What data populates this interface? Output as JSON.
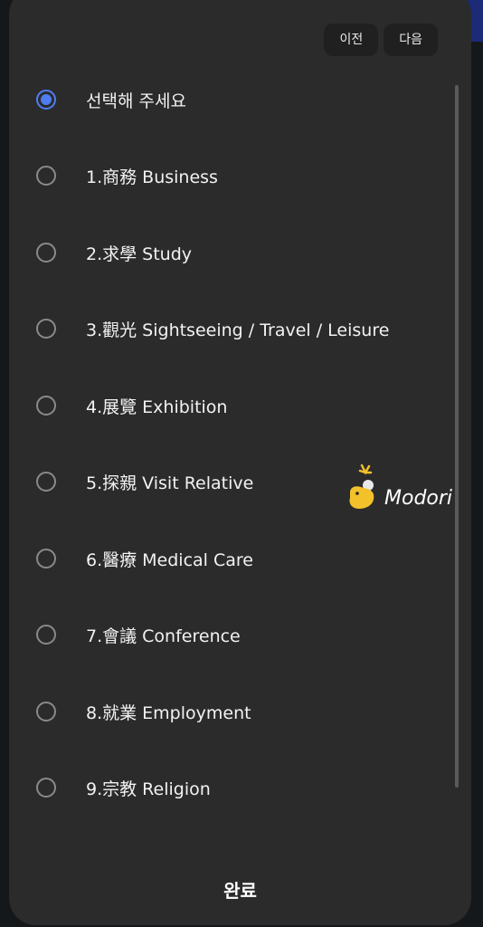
{
  "nav": {
    "prev_label": "이전",
    "next_label": "다음"
  },
  "options": [
    {
      "label": "선택해 주세요",
      "selected": true
    },
    {
      "label": "1.商務 Business",
      "selected": false
    },
    {
      "label": "2.求學 Study",
      "selected": false
    },
    {
      "label": "3.觀光 Sightseeing / Travel / Leisure",
      "selected": false
    },
    {
      "label": "4.展覽 Exhibition",
      "selected": false
    },
    {
      "label": "5.探親 Visit Relative",
      "selected": false
    },
    {
      "label": "6.醫療 Medical Care",
      "selected": false
    },
    {
      "label": "7.會議 Conference",
      "selected": false
    },
    {
      "label": "8.就業 Employment",
      "selected": false
    },
    {
      "label": "9.宗教 Religion",
      "selected": false
    }
  ],
  "done_label": "완료",
  "watermark": {
    "text": "Modori",
    "icon": "duck-logo-icon"
  },
  "colors": {
    "accent": "#4f7df0",
    "sheet": "#2b2b2b",
    "text": "#f2f2f2"
  }
}
